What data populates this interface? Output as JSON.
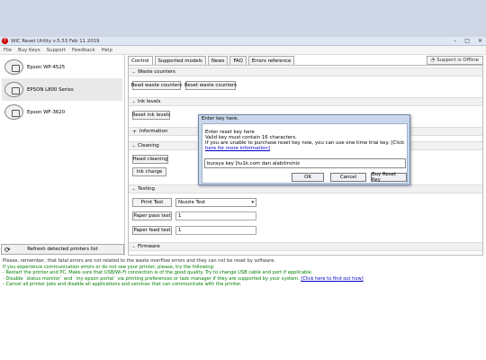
{
  "window": {
    "title": "WIC Reset Utility v.5.53 Feb 11 2019",
    "min": "–",
    "max": "□",
    "close": "✕"
  },
  "menu": [
    "File",
    "Buy Keys",
    "Support",
    "Feedback",
    "Help"
  ],
  "support_button": "Support is Offline",
  "printers": [
    "Epson WP-4525",
    "EPSON L800 Series",
    "Epson WF-3620"
  ],
  "refresh_button": "Refresh detected printers list",
  "tabs": [
    "Control",
    "Supported models",
    "News",
    "FAQ",
    "Errors reference"
  ],
  "sections": {
    "waste": "Waste counters",
    "ink": "Ink levels",
    "information": "Information",
    "cleaning": "Cleaning",
    "testing": "Testing",
    "firmware": "Firmware"
  },
  "buttons": {
    "read_waste": "Read waste counters",
    "reset_waste": "Reset waste counters",
    "reset_ink": "Reset ink levels",
    "head_cleaning": "Head cleaning",
    "ink_charge": "Ink charge",
    "print_test": "Print Test",
    "paper_pass": "Paper pass test",
    "paper_feed": "Paper feed test"
  },
  "testing": {
    "test_select": "Nozzle Test",
    "pass_value": "1",
    "feed_value": "1"
  },
  "dialog": {
    "title": "Enter key here.",
    "line1": "Enter reset key here",
    "line2": "Valid key must contain 16 characters.",
    "line3": "If you are unable to purchase reset key now, you can use one time trial key. [Click",
    "link": "here for more information]",
    "key_value": "buraya key [tu1k.com dan alabilirsiniz",
    "ok": "OK",
    "cancel": "Cancel",
    "buy": "Buy Reset Key"
  },
  "status": {
    "line1": "Please, remember, that fatal errors are not related to the waste overflow errors and they can not be reset by software.",
    "line2": "If you experience communication errors or do not see your printer, please, try the following:",
    "line3": "- Restart the printer and PC. Make sure that USB/Wi-Fi connection is of the good quality. Try to change USB cable and port if applicable.",
    "line4": "- Disable `status monitor` and `my epson portal` via printing preferences or task manager if they are supported by your system.",
    "line4_link": "[Click here to find out how]",
    "line5": "- Cancel all printer jobs and disable all applications and services that can communicate with the printer."
  }
}
